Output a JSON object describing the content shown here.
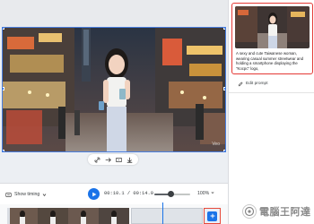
{
  "video": {
    "watermark": "Veo"
  },
  "toolbar": {
    "show_timing_label": "Show timing",
    "time_readout": "00:10.1 / 00:14.0",
    "zoom_value": "100%",
    "zoom_level": 0.45
  },
  "panel": {
    "prompt_text": "A sexy and cute Taiwanese woman, wearing casual summer streetwear and holding a smartphone displaying the \"Kocpc\" logo,",
    "edit_prompt_label": "Edit prompt"
  },
  "logo": {
    "text": "電腦王阿達"
  },
  "colors": {
    "accent": "#1a73e8",
    "selection": "#e53935"
  }
}
